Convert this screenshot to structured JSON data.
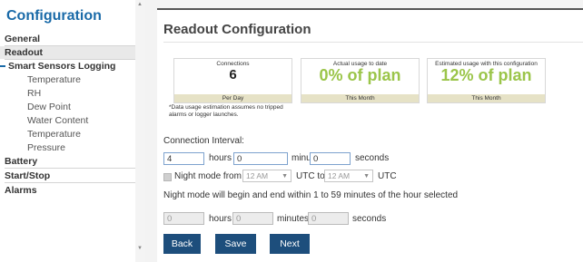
{
  "sidebar": {
    "title": "Configuration",
    "items": [
      {
        "label": "General"
      },
      {
        "label": "Readout"
      },
      {
        "label": "Smart Sensors Logging"
      },
      {
        "label": "Temperature"
      },
      {
        "label": "RH"
      },
      {
        "label": "Dew Point"
      },
      {
        "label": "Water Content"
      },
      {
        "label": "Temperature"
      },
      {
        "label": "Pressure"
      },
      {
        "label": "Battery"
      },
      {
        "label": "Start/Stop"
      },
      {
        "label": "Alarms"
      }
    ]
  },
  "main": {
    "title": "Readout Configuration",
    "stats": [
      {
        "label": "Connections",
        "value": "6",
        "footer": "Per Day"
      },
      {
        "label": "Actual usage to date",
        "value": "0% of plan",
        "footer": "This Month"
      },
      {
        "label": "Estimated usage with this configuration",
        "value": "12% of plan",
        "footer": "This Month"
      }
    ],
    "note": "*Data usage estimation assumes no tripped alarms or logger launches.",
    "interval": {
      "label": "Connection Interval:",
      "hours_value": "4",
      "minutes_value": "0",
      "seconds_value": "0",
      "hours_label": "hours",
      "minutes_label": "minutes",
      "seconds_label": "seconds"
    },
    "night_mode": {
      "label": "Night mode from",
      "from_value": "12 AM",
      "utc_to": "UTC to",
      "to_value": "12 AM",
      "utc": "UTC",
      "info": "Night mode will begin and end within 1 to 59 minutes of the hour selected",
      "hours_value": "0",
      "minutes_value": "0",
      "seconds_value": "0"
    },
    "buttons": {
      "back": "Back",
      "save": "Save",
      "next": "Next"
    }
  },
  "colors": {
    "accent": "#1a6aa8",
    "button": "#1d4e7c",
    "usage_green": "#9bc54a",
    "stat_footer": "#e6e2c6"
  }
}
